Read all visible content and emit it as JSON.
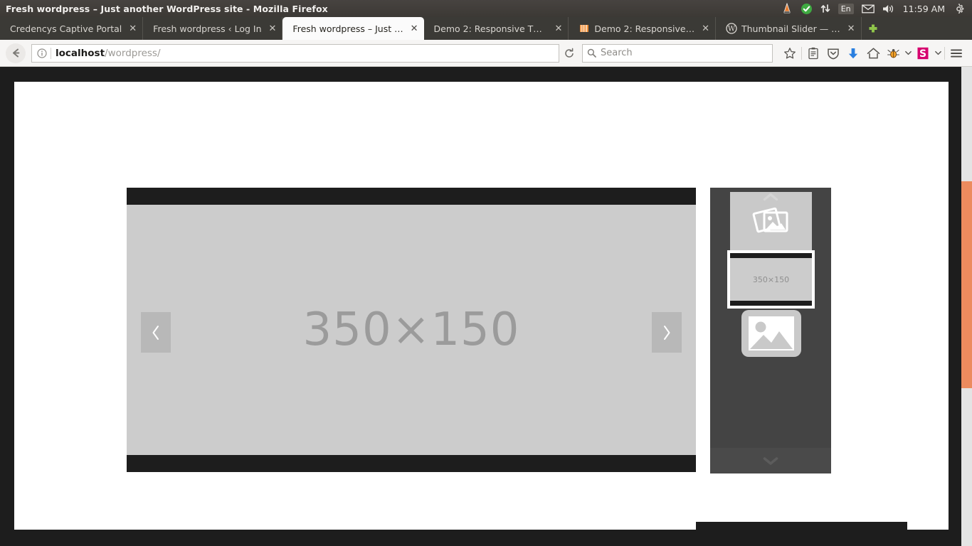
{
  "window": {
    "title": "Fresh wordpress – Just another WordPress site - Mozilla Firefox"
  },
  "system_tray": {
    "items": [
      {
        "name": "vlc-cone-icon",
        "label": "VLC"
      },
      {
        "name": "check-shield-icon",
        "label": "Updates OK"
      },
      {
        "name": "network-updown-icon",
        "label": "Network"
      },
      {
        "name": "keyboard-layout-indicator",
        "label": "En"
      },
      {
        "name": "mail-envelope-icon",
        "label": "Messaging"
      },
      {
        "name": "volume-speaker-icon",
        "label": "Sound"
      }
    ],
    "clock": "11:59 AM",
    "settings_label": "System settings"
  },
  "tabs": [
    {
      "title": "Credencys Captive Portal",
      "close": "✕",
      "active": false,
      "favicon": "none"
    },
    {
      "title": "Fresh wordpress ‹ Log In",
      "close": "✕",
      "active": false,
      "favicon": "none"
    },
    {
      "title": "Fresh wordpress – Just …",
      "close": "✕",
      "active": true,
      "favicon": "none"
    },
    {
      "title": "Demo 2: Responsive Th…",
      "close": "✕",
      "active": false,
      "favicon": "none"
    },
    {
      "title": "Demo 2: Responsive…",
      "close": "✕",
      "active": false,
      "favicon": "orange-grid"
    },
    {
      "title": "Thumbnail Slider — …",
      "close": "✕",
      "active": false,
      "favicon": "wordpress"
    }
  ],
  "new_tab_label": "+",
  "toolbar": {
    "back_label": "Back",
    "identity_label": "Site information",
    "url_host": "localhost",
    "url_path": "/wordpress/",
    "reload_label": "Reload",
    "search_placeholder": "Search",
    "search_value": "",
    "buttons": [
      {
        "name": "bookmark-star-icon",
        "label": "Bookmark this page"
      },
      {
        "name": "reader-list-icon",
        "label": "Reading list"
      },
      {
        "name": "pocket-shield-icon",
        "label": "Save to Pocket"
      },
      {
        "name": "downloads-arrow-icon",
        "label": "Downloads"
      },
      {
        "name": "home-icon",
        "label": "Home"
      },
      {
        "name": "firebug-icon",
        "label": "Firebug"
      },
      {
        "name": "selenium-icon",
        "label": "Selenium IDE"
      },
      {
        "name": "hamburger-menu-icon",
        "label": "Open menu"
      }
    ]
  },
  "page": {
    "scrollbar": {
      "thumb_color": "#ec8b5e",
      "track_color": "#e4e4e4"
    },
    "slider": {
      "main_slide": {
        "label": "350×150",
        "bg_color": "#cccccc",
        "frame_color": "#1d1d1d"
      },
      "prev_arrow": "‹",
      "next_arrow": "›",
      "rail": {
        "bg_color": "#444444",
        "scroll_up": "⌃",
        "scroll_down": "⌄",
        "thumbnails": [
          {
            "name": "thumbnail-1",
            "type": "stacked-photos-icon",
            "label": "",
            "selected": false
          },
          {
            "name": "thumbnail-2",
            "type": "slide-preview",
            "label": "350×150",
            "selected": true
          },
          {
            "name": "thumbnail-3",
            "type": "single-photo-icon",
            "label": "",
            "selected": false
          }
        ]
      }
    }
  }
}
